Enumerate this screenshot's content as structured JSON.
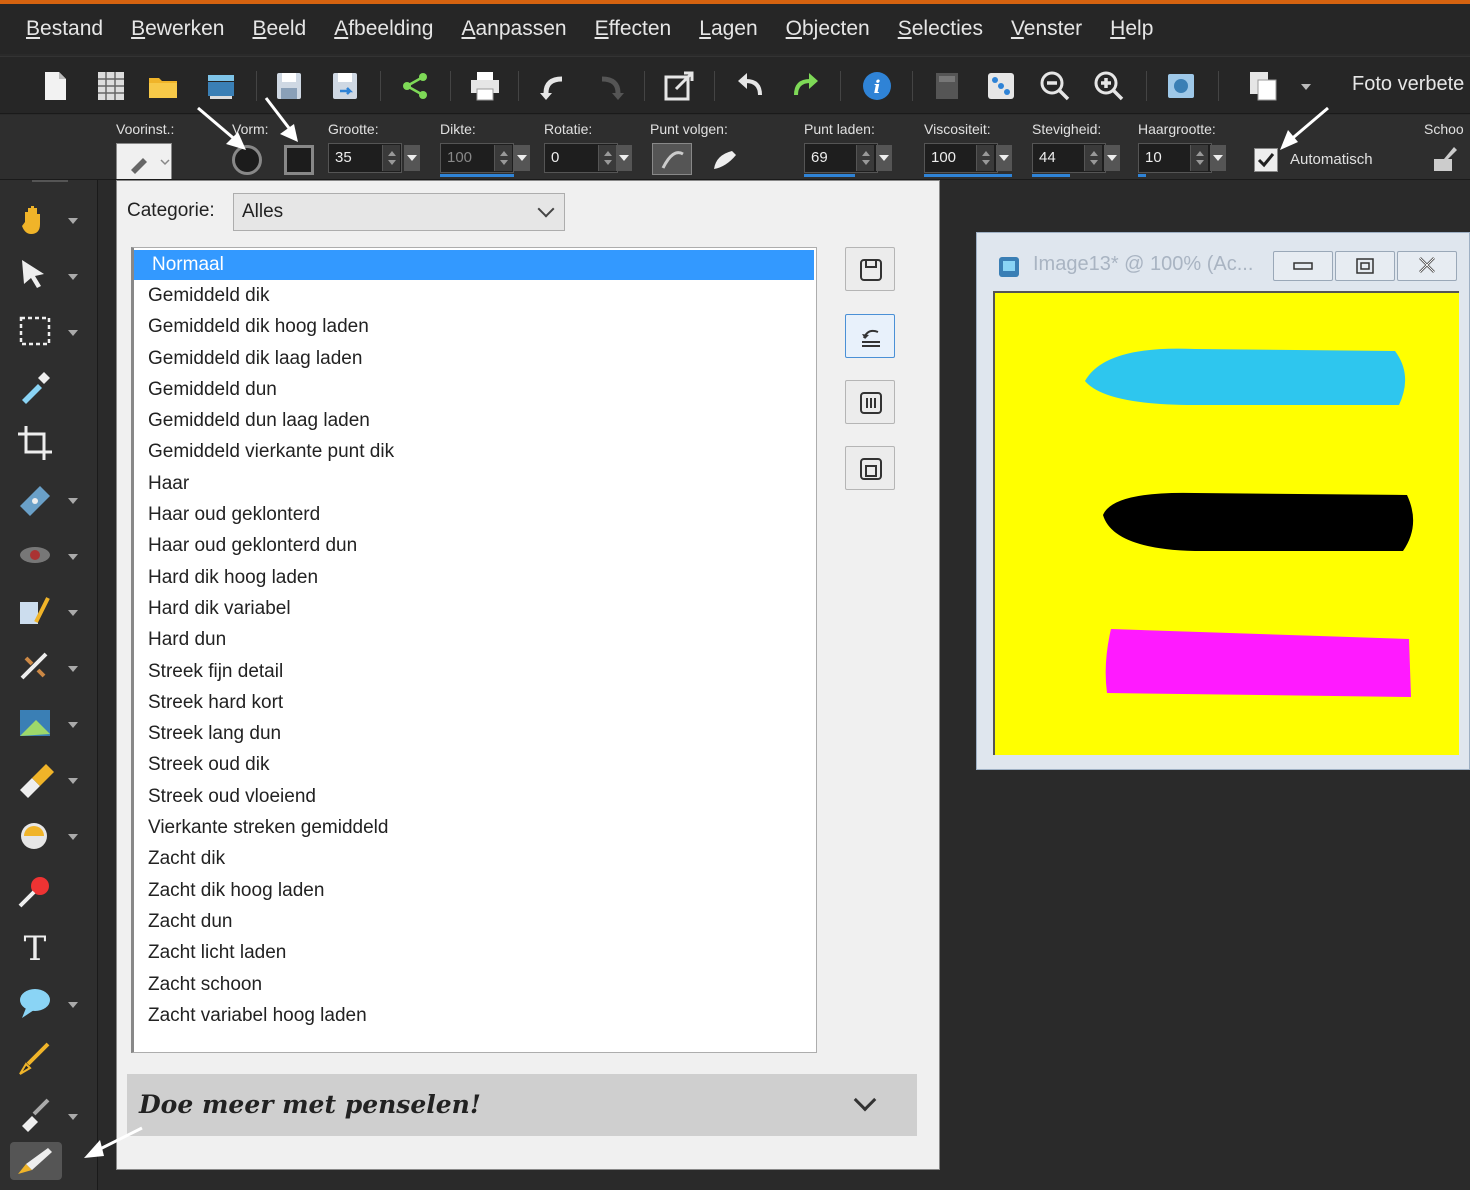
{
  "menu": [
    "Bestand",
    "Bewerken",
    "Beeld",
    "Afbeelding",
    "Aanpassen",
    "Effecten",
    "Lagen",
    "Objecten",
    "Selecties",
    "Venster",
    "Help"
  ],
  "toolbar": {
    "foto_label": "Foto verbete"
  },
  "options": {
    "voorinst_label": "Voorinst.:",
    "vorm_label": "Vorm:",
    "grootte_label": "Grootte:",
    "grootte_value": "35",
    "dikte_label": "Dikte:",
    "dikte_value": "100",
    "rotatie_label": "Rotatie:",
    "rotatie_value": "0",
    "punt_volgen_label": "Punt volgen:",
    "punt_laden_label": "Punt laden:",
    "punt_laden_value": "69",
    "viscositeit_label": "Viscositeit:",
    "viscositeit_value": "100",
    "stevigheid_label": "Stevigheid:",
    "stevigheid_value": "44",
    "haargrootte_label": "Haargrootte:",
    "haargrootte_value": "10",
    "automatisch_label": "Automatisch",
    "schoon_label": "Schoo"
  },
  "popup": {
    "categorie_label": "Categorie:",
    "categorie_value": "Alles",
    "presets": [
      "Normaal",
      "Gemiddeld dik",
      "Gemiddeld dik hoog laden",
      "Gemiddeld dik laag laden",
      "Gemiddeld dun",
      "Gemiddeld dun laag laden",
      "Gemiddeld vierkante punt dik",
      "Haar",
      "Haar oud geklonterd",
      "Haar oud geklonterd dun",
      "Hard dik hoog laden",
      "Hard dik variabel",
      "Hard dun",
      "Streek fijn detail",
      "Streek hard kort",
      "Streek lang dun",
      "Streek oud dik",
      "Streek oud vloeiend",
      "Vierkante streken gemiddeld",
      "Zacht dik",
      "Zacht dik hoog laden",
      "Zacht dun",
      "Zacht licht laden",
      "Zacht schoon",
      "Zacht variabel hoog laden"
    ],
    "selected_index": 0,
    "more_text": "Doe meer met penselen!"
  },
  "image_window": {
    "title": "Image13* @ 100% (Ac..."
  },
  "colors": {
    "canvas": "#ffff00",
    "stroke1": "#2ec6ee",
    "stroke2": "#000000",
    "stroke3": "#ff1aff",
    "accent": "#3399ff"
  }
}
